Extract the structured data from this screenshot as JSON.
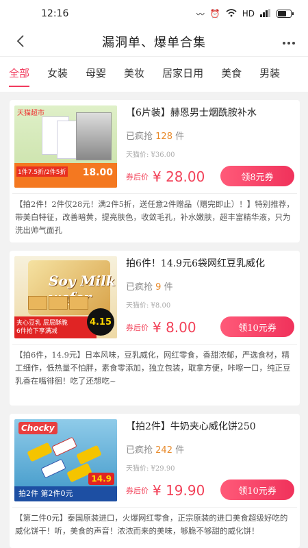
{
  "status_bar": {
    "time": "12:16",
    "network": "HD"
  },
  "nav": {
    "title": "漏洞单、爆单合集"
  },
  "tabs": [
    "全部",
    "女装",
    "母婴",
    "美妆",
    "居家日用",
    "美食",
    "男装"
  ],
  "products": [
    {
      "title": "【6片装】赫恩男士烟酰胺补水",
      "sold_prefix": "已疯抢",
      "sold_count": "128",
      "sold_unit": "件",
      "tmall_price": "天猫价: ¥36.00",
      "price_label": "券后价",
      "price": "¥ 28.00",
      "coupon": "领8元券",
      "description": "【拍2件！2件仅28元！满2件5折，送任意2件赠品（赠完即止）！】特别推荐，带美白特征，改善暗黄，提亮肤色，收敛毛孔，补水嫩肤，超丰富精华液，只为洗出帅气面孔",
      "thumb": {
        "badge": "天猫超市",
        "promo": "1件7.5折/2件5折",
        "promo_price": "18.00"
      }
    },
    {
      "title": "拍6件！14.9元6袋网红豆乳威化",
      "sold_prefix": "已疯抢",
      "sold_count": "9",
      "sold_unit": "件",
      "tmall_price": "天猫价: ¥8.00",
      "price_label": "券后价",
      "price": "¥ 8.00",
      "coupon": "领10元券",
      "description": "【拍6件，14.9元】日本风味，豆乳威化，网红零食，香甜浓郁，严选食材，精工细作，低热量不怕胖，素食零添加，独立包装，取拿方便，咔嚓一口，纯正豆乳香在嘴徘徊！吃了还想吃~",
      "thumb": {
        "brand": "Soy Milk wafer",
        "banner1": "夹心豆乳 层层酥脆",
        "banner2": "6件抢下享满减",
        "price": "4.15"
      }
    },
    {
      "title": "【拍2件】牛奶夹心威化饼250",
      "sold_prefix": "已疯抢",
      "sold_count": "242",
      "sold_unit": "件",
      "tmall_price": "天猫价: ¥29.90",
      "price_label": "券后价",
      "price": "¥ 19.90",
      "coupon": "领10元券",
      "description": "【第二件0元】泰国原装进口，火爆网红零食，正宗原装的进口美食超级好吃的威化饼干！听，美食的声音！浓浓而来的美味，够脆不够甜的威化饼！",
      "thumb": {
        "brand": "Chocky",
        "strip": "拍2件 第2件0元",
        "price": "14.9"
      }
    }
  ],
  "colors": {
    "accent": "#f13a5d",
    "price": "#f24259",
    "sold": "#e88a2a"
  }
}
